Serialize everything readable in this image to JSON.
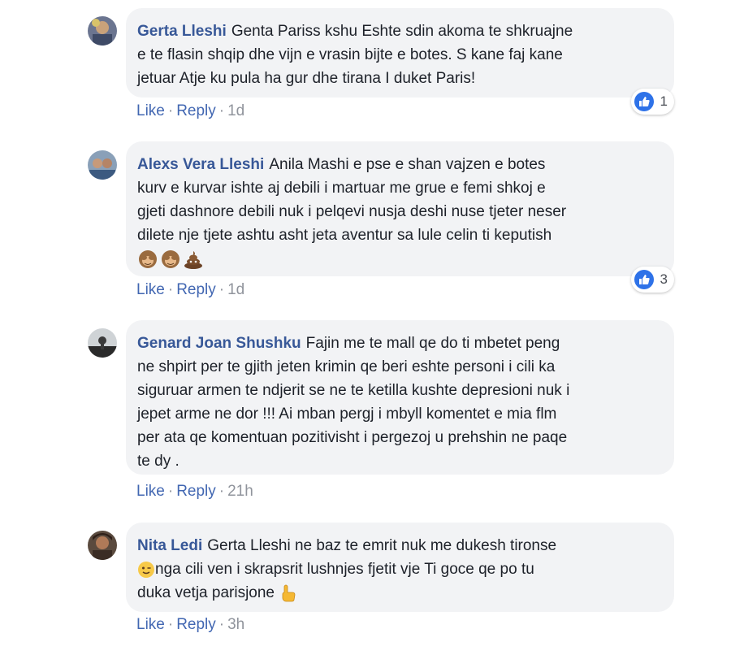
{
  "comments": [
    {
      "author": "Gerta Lleshi",
      "text": "Genta Pariss kshu Eshte sdin akoma te shkruajne\ne te flasin shqip dhe vijn e vrasin bijte e botes. S kane faj kane\njetuar Atje ku pula ha gur dhe tirana I duket Paris!",
      "like_label": "Like",
      "reply_label": "Reply",
      "time": "1d",
      "reaction_count": "1"
    },
    {
      "author": "Alexs Vera Lleshi",
      "text": "Anila Mashi e pse e shan vajzen e botes\nkurv e kurvar ishte aj debili i martuar me grue e femi shkoj e\ngjeti dashnore debili nuk i pelqevi nusja deshi nuse tjeter neser\ndilete nje tjete ashtu asht jeta aventur sa lule celin ti keputish",
      "emojis": [
        "see-no-evil-monkey",
        "see-no-evil-monkey",
        "pile-of-poo"
      ],
      "like_label": "Like",
      "reply_label": "Reply",
      "time": "1d",
      "reaction_count": "3"
    },
    {
      "author": "Genard Joan Shushku",
      "text": "Fajin me te mall qe do ti mbetet peng\nne shpirt per te gjith jeten krimin qe beri eshte personi i cili ka\nsiguruar armen te ndjerit se ne te ketilla kushte depresioni nuk i\njepet arme ne dor !!! Ai mban pergj i mbyll komentet e mia flm\nper ata qe komentuan pozitivisht i pergezoj u prehshin ne paqe\nte dy .",
      "like_label": "Like",
      "reply_label": "Reply",
      "time": "21h"
    },
    {
      "author": "Nita Ledi",
      "text_line1": "Gerta Lleshi ne baz te emrit nuk me dukesh tironse",
      "text_line2": "nga cili ven i skrapsrit lushnjes fjetit vje Ti goce qe po tu",
      "text_line3": "duka vetja parisjone",
      "emoji_wink": "winking-face",
      "emoji_point": "pointing-hand",
      "like_label": "Like",
      "reply_label": "Reply",
      "time": "3h"
    }
  ],
  "colors": {
    "name": "#385898",
    "link": "#4267b2",
    "bubble": "#f2f3f5",
    "like_badge": "#2e72e8"
  }
}
